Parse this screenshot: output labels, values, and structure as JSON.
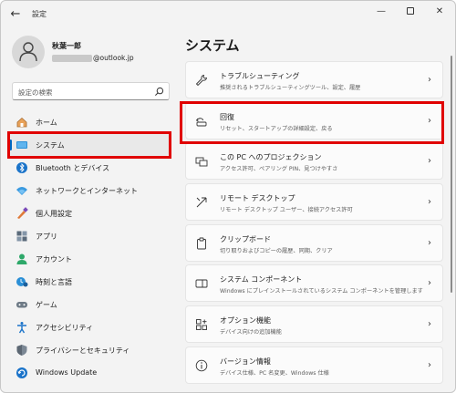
{
  "window": {
    "title": "設定",
    "back_glyph": "←",
    "min_glyph": "—",
    "close_glyph": "✕"
  },
  "profile": {
    "name": "秋葉一郎",
    "email_suffix": "@outlook.jp"
  },
  "search": {
    "placeholder": "設定の検索"
  },
  "nav": [
    {
      "label": "ホーム",
      "icon": "home-icon"
    },
    {
      "label": "システム",
      "icon": "system-icon",
      "selected": true
    },
    {
      "label": "Bluetooth とデバイス",
      "icon": "bluetooth-icon"
    },
    {
      "label": "ネットワークとインターネット",
      "icon": "network-icon"
    },
    {
      "label": "個人用設定",
      "icon": "personalization-icon"
    },
    {
      "label": "アプリ",
      "icon": "apps-icon"
    },
    {
      "label": "アカウント",
      "icon": "account-icon"
    },
    {
      "label": "時刻と言語",
      "icon": "time-language-icon"
    },
    {
      "label": "ゲーム",
      "icon": "gaming-icon"
    },
    {
      "label": "アクセシビリティ",
      "icon": "accessibility-icon"
    },
    {
      "label": "プライバシーとセキュリティ",
      "icon": "privacy-icon"
    },
    {
      "label": "Windows Update",
      "icon": "windows-update-icon"
    }
  ],
  "main": {
    "title": "システム",
    "cards": [
      {
        "title": "トラブルシューティング",
        "subtitle": "推奨されるトラブルシューティングツール、設定、履歴",
        "icon": "troubleshoot-icon"
      },
      {
        "title": "回復",
        "subtitle": "リセット、スタートアップの詳細設定、戻る",
        "icon": "recovery-icon"
      },
      {
        "title": "この PC へのプロジェクション",
        "subtitle": "アクセス許可、ペアリング PIN、見つけやすさ",
        "icon": "projection-icon"
      },
      {
        "title": "リモート デスクトップ",
        "subtitle": "リモート デスクトップ ユーザー、接続アクセス許可",
        "icon": "remote-desktop-icon"
      },
      {
        "title": "クリップボード",
        "subtitle": "切り取りおよびコピーの履歴、同期、クリア",
        "icon": "clipboard-icon"
      },
      {
        "title": "システム コンポーネント",
        "subtitle": "Windows にプレインストールされているシステム コンポーネントを管理します",
        "icon": "system-components-icon"
      },
      {
        "title": "オプション機能",
        "subtitle": "デバイス向けの追加機能",
        "icon": "optional-features-icon"
      },
      {
        "title": "バージョン情報",
        "subtitle": "デバイス仕様、PC 名変更、Windows 仕様",
        "icon": "about-icon"
      }
    ],
    "chevron": "›"
  },
  "colors": {
    "accent": "#0067c0",
    "highlight": "#e00000",
    "background": "#f3f3f3"
  }
}
